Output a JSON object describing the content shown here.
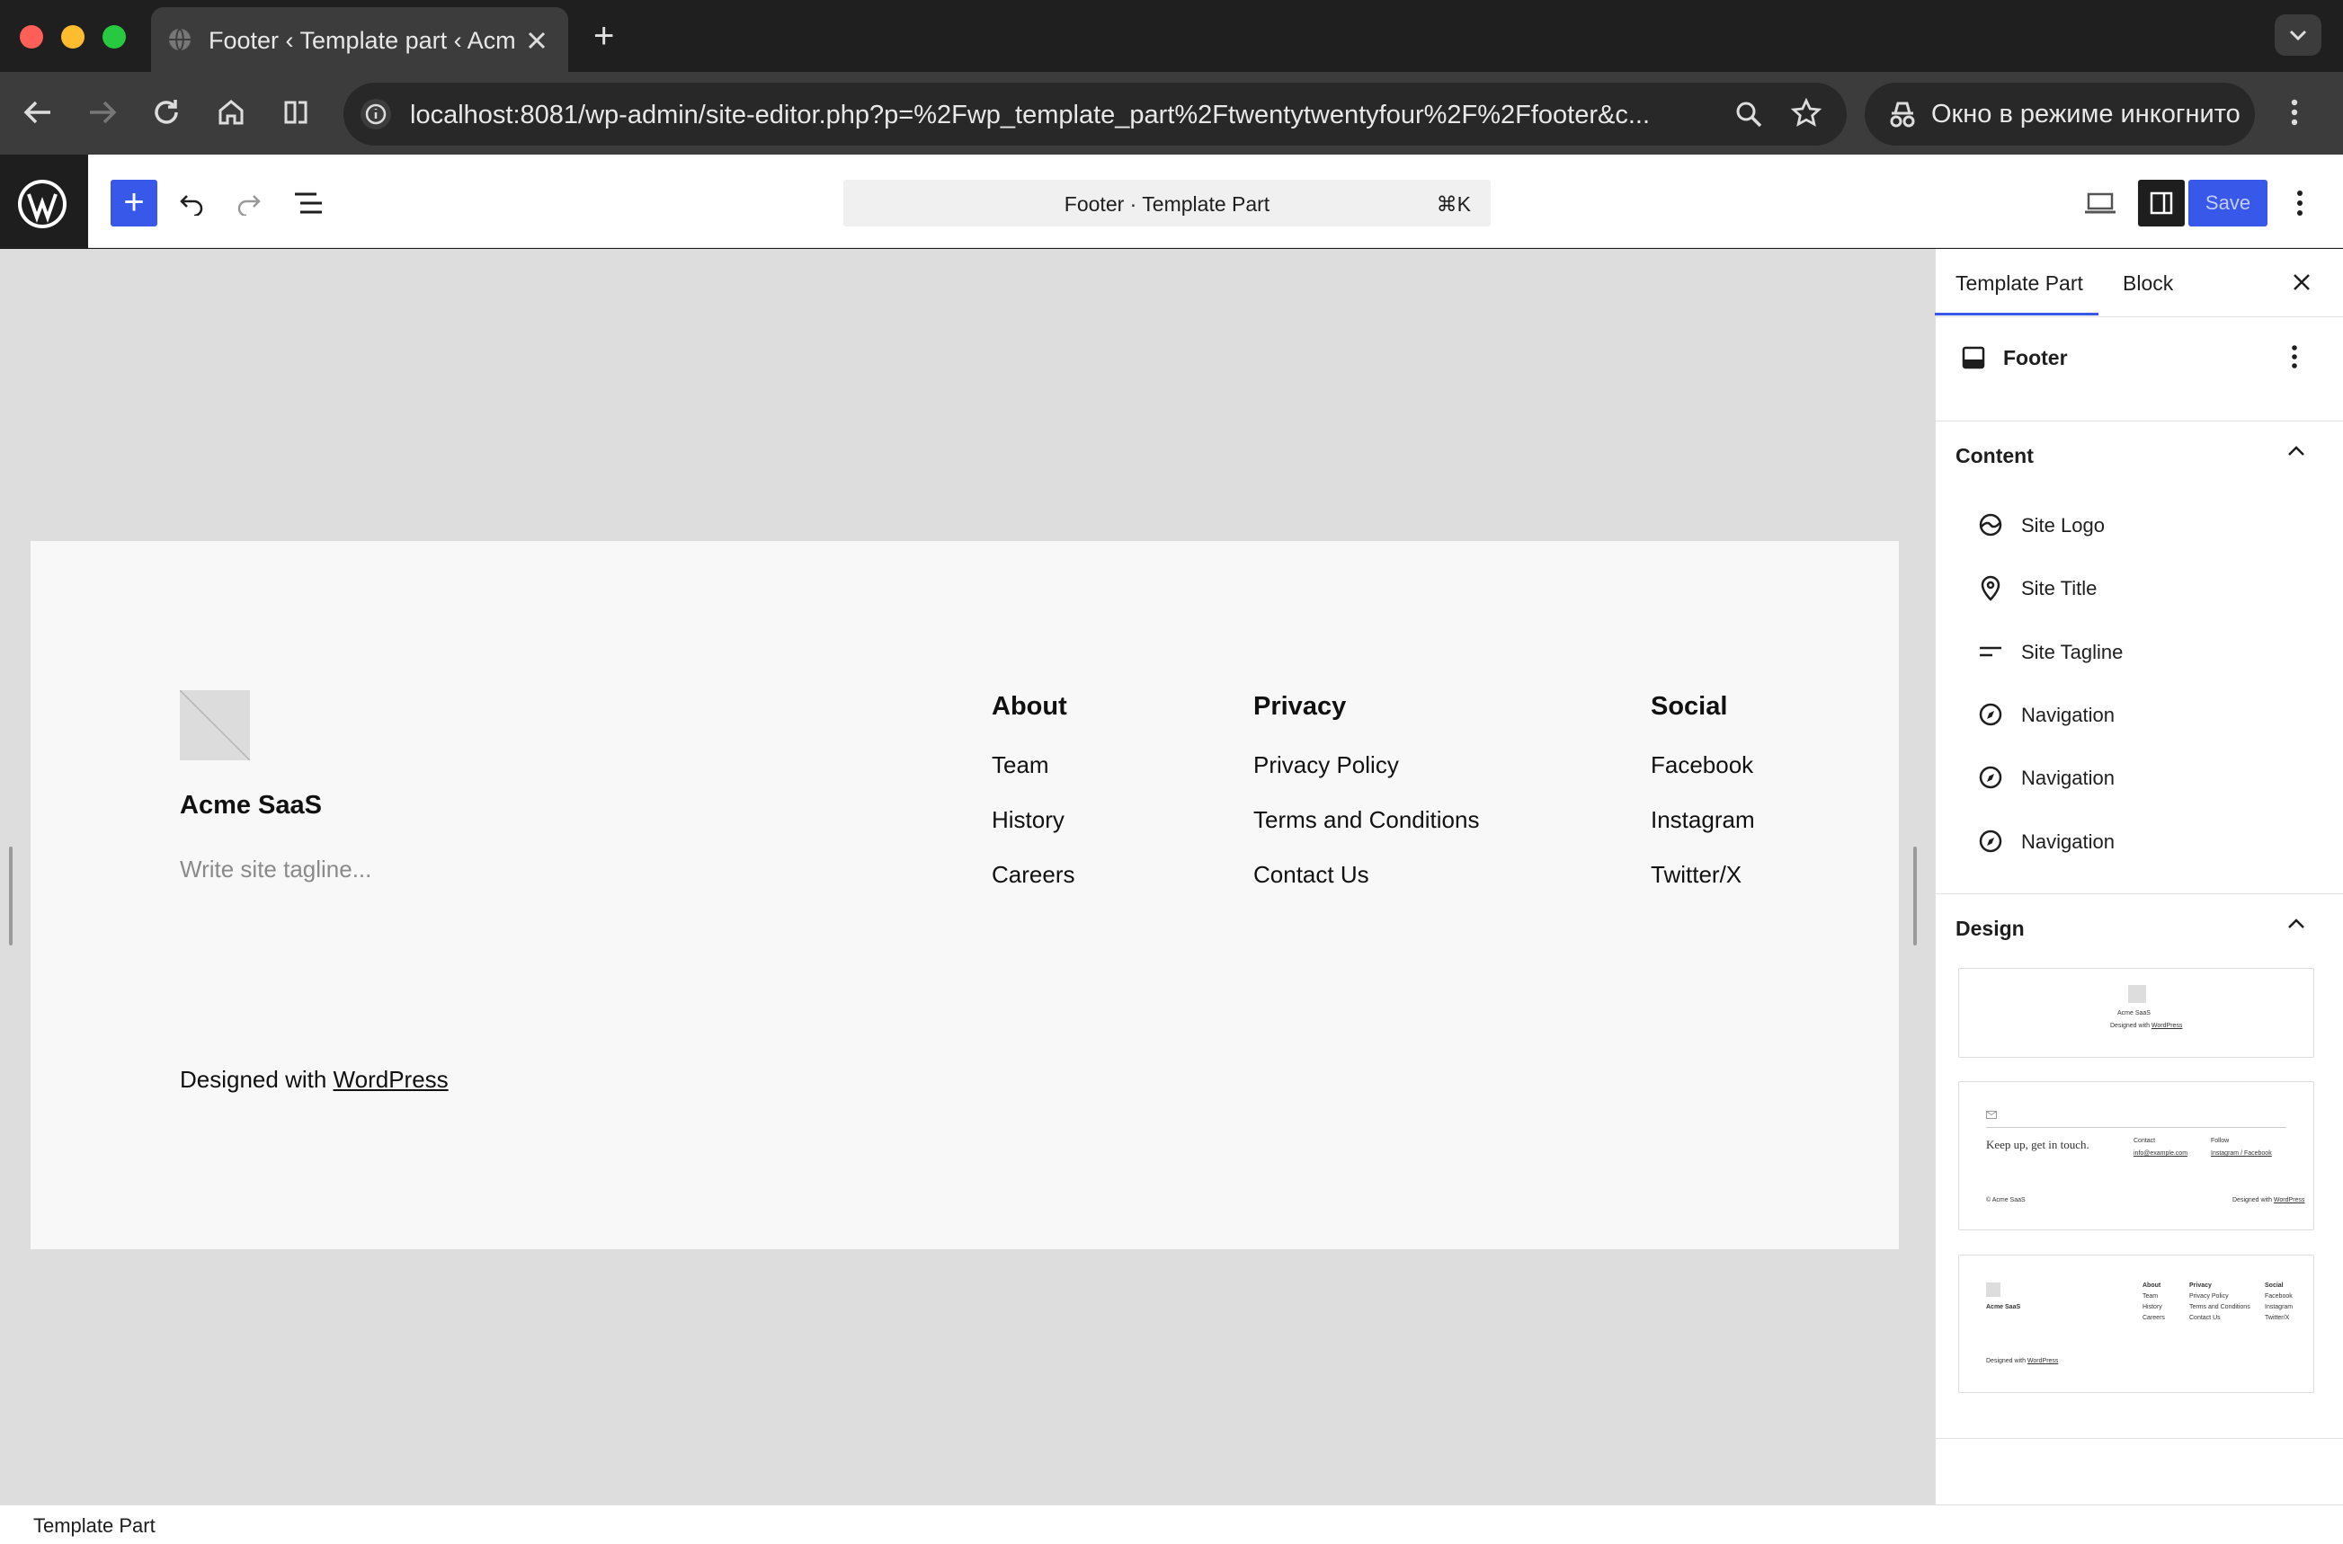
{
  "browser": {
    "tab_title": "Footer ‹ Template part ‹ Acme",
    "url": "localhost:8081/wp-admin/site-editor.php?p=%2Fwp_template_part%2Ftwentytwentyfour%2F%2Ffooter&c...",
    "incognito_label": "Окно в режиме инкогнито",
    "new_tab": "+"
  },
  "editor": {
    "command_bar_title": "Footer · Template Part",
    "command_shortcut": "⌘K",
    "save_label": "Save",
    "add_label": "+"
  },
  "canvas": {
    "site_title": "Acme SaaS",
    "tagline_placeholder": "Write site tagline...",
    "footer_credit_prefix": "Designed with ",
    "footer_credit_link": "WordPress",
    "columns": [
      {
        "heading": "About",
        "links": [
          "Team",
          "History",
          "Careers"
        ]
      },
      {
        "heading": "Privacy",
        "links": [
          "Privacy Policy",
          "Terms and Conditions",
          "Contact Us"
        ]
      },
      {
        "heading": "Social",
        "links": [
          "Facebook",
          "Instagram",
          "Twitter/X"
        ]
      }
    ]
  },
  "sidebar": {
    "tabs": [
      "Template Part",
      "Block"
    ],
    "active_tab": "Template Part",
    "template_name": "Footer",
    "content_title": "Content",
    "content_items": [
      {
        "label": "Site Logo",
        "icon": "site-logo-icon"
      },
      {
        "label": "Site Title",
        "icon": "map-marker-icon"
      },
      {
        "label": "Site Tagline",
        "icon": "tagline-icon"
      },
      {
        "label": "Navigation",
        "icon": "compass-icon"
      },
      {
        "label": "Navigation",
        "icon": "compass-icon"
      },
      {
        "label": "Navigation",
        "icon": "compass-icon"
      }
    ],
    "design_title": "Design",
    "patterns": {
      "p1": {
        "site": "Acme SaaS",
        "credit_prefix": "Designed with ",
        "credit_link": "WordPress"
      },
      "p2": {
        "headline": "Keep up, get in touch.",
        "contact_label": "Contact",
        "contact_value": "info@example.com",
        "follow_label": "Follow",
        "follow_links": "Instagram / Facebook",
        "site": "© Acme SaaS",
        "credit_prefix": "Designed with ",
        "credit_link": "WordPress"
      },
      "p3": {
        "site": "Acme SaaS",
        "credit_prefix": "Designed with ",
        "credit_link": "WordPress"
      }
    }
  },
  "statusbar": {
    "label": "Template Part"
  },
  "colors": {
    "accent": "#3858e9",
    "canvas_bg": "#dddddd",
    "frame_bg": "#f8f8f8"
  }
}
